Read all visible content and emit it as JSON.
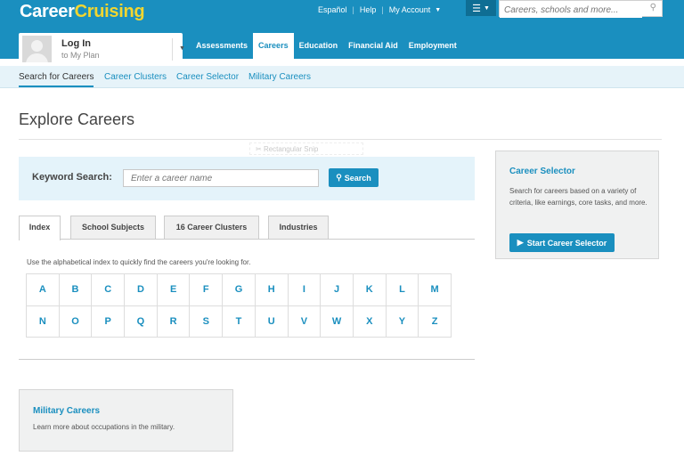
{
  "header": {
    "logo_part1": "Career",
    "logo_part2": "Cruising",
    "top_links": [
      "Español",
      "Help",
      "My Account"
    ],
    "search_placeholder": "Careers, schools and more...",
    "colors": {
      "brand": "#1a8fbf",
      "logo_accent": "#f2d630"
    }
  },
  "login": {
    "title": "Log In",
    "subtitle": "to My Plan"
  },
  "main_nav": [
    "Assessments",
    "Careers",
    "Education",
    "Financial Aid",
    "Employment"
  ],
  "sub_nav": [
    "Search for Careers",
    "Career Clusters",
    "Career Selector",
    "Military Careers"
  ],
  "page_title": "Explore Careers",
  "ghost_label": "Rectangular Snip",
  "keyword_search": {
    "label": "Keyword Search:",
    "placeholder": "Enter a career name",
    "button": "Search"
  },
  "tabs": [
    "Index",
    "School Subjects",
    "16 Career Clusters",
    "Industries"
  ],
  "index_note": "Use the alphabetical index to quickly find the careers you're looking for.",
  "letters": [
    "A",
    "B",
    "C",
    "D",
    "E",
    "F",
    "G",
    "H",
    "I",
    "J",
    "K",
    "L",
    "M",
    "N",
    "O",
    "P",
    "Q",
    "R",
    "S",
    "T",
    "U",
    "V",
    "W",
    "X",
    "Y",
    "Z"
  ],
  "military": {
    "title": "Military Careers",
    "description": "Learn more about occupations in the military."
  },
  "career_selector": {
    "title": "Career Selector",
    "description": "Search for careers based on a variety of criteria, like earnings, core tasks, and more.",
    "button": "Start Career Selector"
  }
}
